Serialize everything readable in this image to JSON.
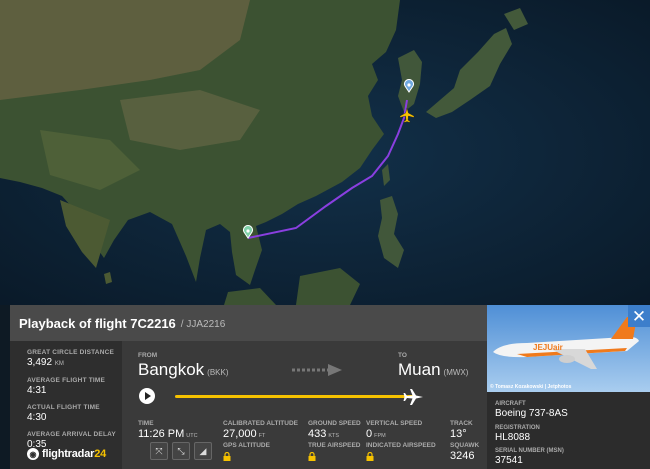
{
  "map": {
    "origin_pin": "location-pin-icon",
    "destination_pin": "location-pin-icon",
    "aircraft": "airplane-icon",
    "route_color": "#8a3fe0"
  },
  "header": {
    "title": "Playback of flight 7C2216",
    "callsign": "/ JJA2216"
  },
  "stats": {
    "distance_label": "GREAT CIRCLE DISTANCE",
    "distance_value": "3,492",
    "distance_unit": "KM",
    "avg_time_label": "AVERAGE FLIGHT TIME",
    "avg_time_value": "4:31",
    "actual_time_label": "ACTUAL FLIGHT TIME",
    "actual_time_value": "4:30",
    "delay_label": "AVERAGE ARRIVAL DELAY",
    "delay_value": "0:35"
  },
  "logo": {
    "text": "flightradar",
    "num": "24"
  },
  "route": {
    "from_label": "FROM",
    "from_city": "Bangkok",
    "from_iata": "(BKK)",
    "to_label": "TO",
    "to_city": "Muan",
    "to_iata": "(MWX)",
    "progress": 1.0
  },
  "metrics": {
    "time_label": "TIME",
    "time_value": "11:26 PM",
    "time_unit": "UTC",
    "cal_alt_label": "CALIBRATED ALTITUDE",
    "cal_alt_value": "27,000",
    "cal_alt_unit": "FT",
    "gps_alt_label": "GPS ALTITUDE",
    "ground_speed_label": "GROUND SPEED",
    "ground_speed_value": "433",
    "ground_speed_unit": "KTS",
    "true_airspeed_label": "TRUE AIRSPEED",
    "vertical_speed_label": "VERTICAL SPEED",
    "vertical_speed_value": "0",
    "vertical_speed_unit": "FPM",
    "indicated_airspeed_label": "INDICATED AIRSPEED",
    "track_label": "TRACK",
    "track_value": "13°",
    "squawk_label": "SQUAWK",
    "squawk_value": "3246"
  },
  "controls": {
    "expand": "expand-icon",
    "route": "route-icon",
    "chart": "chart-icon"
  },
  "aircraft": {
    "photo_credit": "© Tomasz Kozakowski | Jetphotos",
    "aircraft_label": "AIRCRAFT",
    "aircraft_value": "Boeing 737-8AS",
    "registration_label": "REGISTRATION",
    "registration_value": "HL8088",
    "serial_label": "SERIAL NUMBER (MSN)",
    "serial_value": "37541",
    "close": "close-icon",
    "livery_text": "JEJUair"
  }
}
